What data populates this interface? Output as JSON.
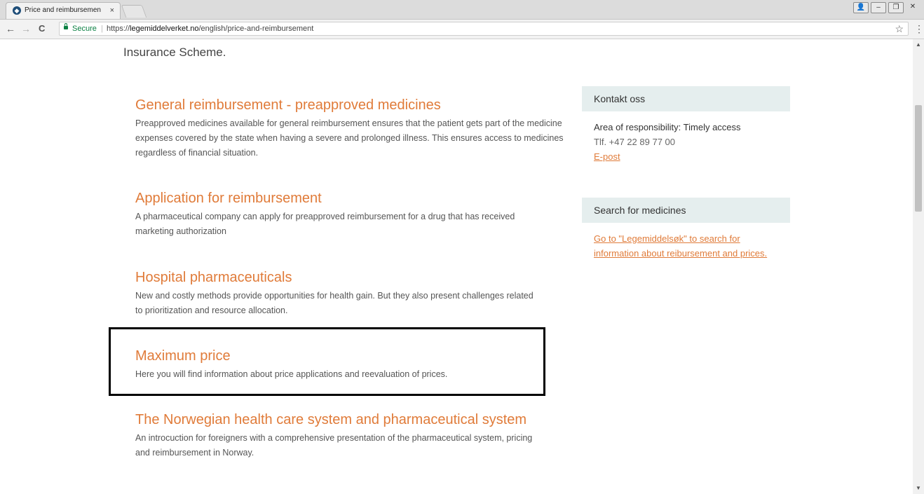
{
  "browser": {
    "tab_title": "Price and reimbursemen",
    "tab_close": "×",
    "favicon_glyph": "◆",
    "window_controls": [
      "👤",
      "–",
      "❐",
      "✕"
    ],
    "nav": {
      "back": "←",
      "forward": "→",
      "reload": "C"
    },
    "secure_label": "Secure",
    "url_sep": "|",
    "url_scheme": "https://",
    "url_host": "legemiddelverket.no",
    "url_path": "/english/price-and-reimbursement",
    "star": "☆",
    "menu": "⋮"
  },
  "page": {
    "intro_text": "Insurance Scheme.",
    "items": [
      {
        "title": "General reimbursement - preapproved medicines",
        "desc": "Preapproved medicines available for general reimbursement ensures that the patient gets part of the medicine expenses covered by the state when having a severe and prolonged illness. This ensures access to medicines regardless of financial situation."
      },
      {
        "title": "Application for reimbursement",
        "desc": "A pharmaceutical company can apply for preapproved reimbursement for a drug that has received marketing authorization"
      },
      {
        "title": "Hospital pharmaceuticals",
        "desc": "New and costly methods provide opportunities for health gain. But they also present challenges related to prioritization and resource allocation."
      },
      {
        "title": "Maximum price",
        "desc": "Here you will find information about price applications and reevaluation of prices."
      },
      {
        "title": "The Norwegian health care system and pharmaceutical system",
        "desc": "An introcuction for foreigners with a comprehensive presentation of the pharmaceutical system, pricing and reimbursement in Norway."
      }
    ]
  },
  "sidebar": {
    "contact": {
      "heading": "Kontakt oss",
      "area": "Area of responsibility: Timely access",
      "phone": "Tlf. +47 22 89 77 00",
      "email_link": "E-post"
    },
    "search": {
      "heading": "Search for medicines",
      "link": "Go to \"Legemiddelsøk\" to search for information about reibursement and prices."
    }
  },
  "scrollbar": {
    "up": "▲",
    "down": "▼"
  },
  "colors": {
    "accent": "#e07b39",
    "sidebar_head_bg": "#e5eeee",
    "secure_green": "#0b8043"
  }
}
